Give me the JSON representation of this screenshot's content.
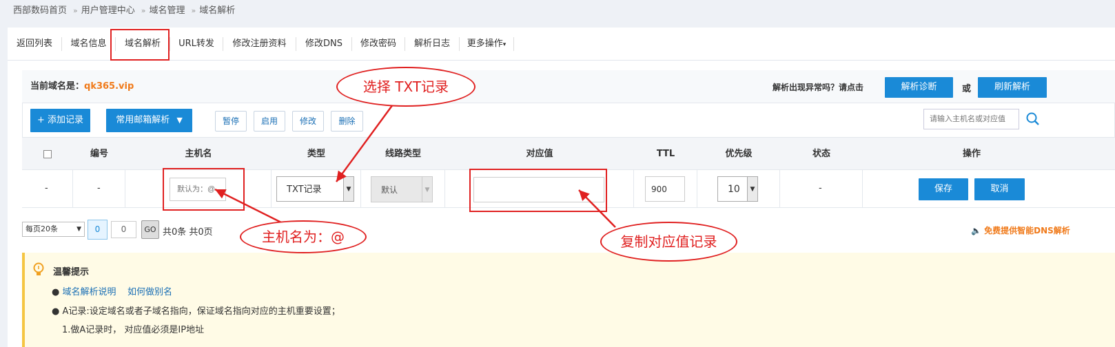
{
  "breadcrumb": {
    "items": [
      "西部数码首页",
      "用户管理中心",
      "域名管理",
      "域名解析"
    ],
    "separator": "»"
  },
  "tabs": [
    "返回列表",
    "域名信息",
    "域名解析",
    "URL转发",
    "修改注册资料",
    "修改DNS",
    "修改密码",
    "解析日志",
    "更多操作"
  ],
  "domain": {
    "label": "当前域名是：",
    "name": "qk365.vip"
  },
  "diagnose": {
    "question": "解析出现异常吗？请点击",
    "diag_btn": "解析诊断",
    "or": "或",
    "refresh_btn": "刷新解析"
  },
  "toolbar": {
    "add": "+ 添加记录",
    "mail": "常用邮箱解析",
    "pause": "暂停",
    "enable": "启用",
    "modify": "修改",
    "delete": "删除",
    "search_placeholder": "请输入主机名或对应值"
  },
  "columns": [
    "编号",
    "主机名",
    "类型",
    "线路类型",
    "对应值",
    "TTL",
    "优先级",
    "状态",
    "操作"
  ],
  "row": {
    "dash1": "-",
    "dash2": "-",
    "host_placeholder": "默认为：@",
    "type": "TXT记录",
    "line": "默认",
    "value": "",
    "ttl": "900",
    "priority": "10",
    "status": "-",
    "save": "保存",
    "cancel": "取消"
  },
  "pager": {
    "per_page": "每页20条",
    "current": "0",
    "goto": "0",
    "go": "GO",
    "summary": "共0条 共0页"
  },
  "promo": "免费提供智能DNS解析",
  "annotations": {
    "select_txt": "选择 TXT记录",
    "host_at": "主机名为：@",
    "copy_value": "复制对应值记录"
  },
  "tips": {
    "title": "温馨提示",
    "link1": "域名解析说明",
    "link2": "如何做别名",
    "line1": "A记录:设定域名或者子域名指向，保证域名指向对应的主机重要设置；",
    "line2": "1.做A记录时， 对应值必须是IP地址"
  },
  "colors": {
    "accent": "#1a8ad7",
    "annotation": "#e02020",
    "domain": "#f07a1a"
  }
}
